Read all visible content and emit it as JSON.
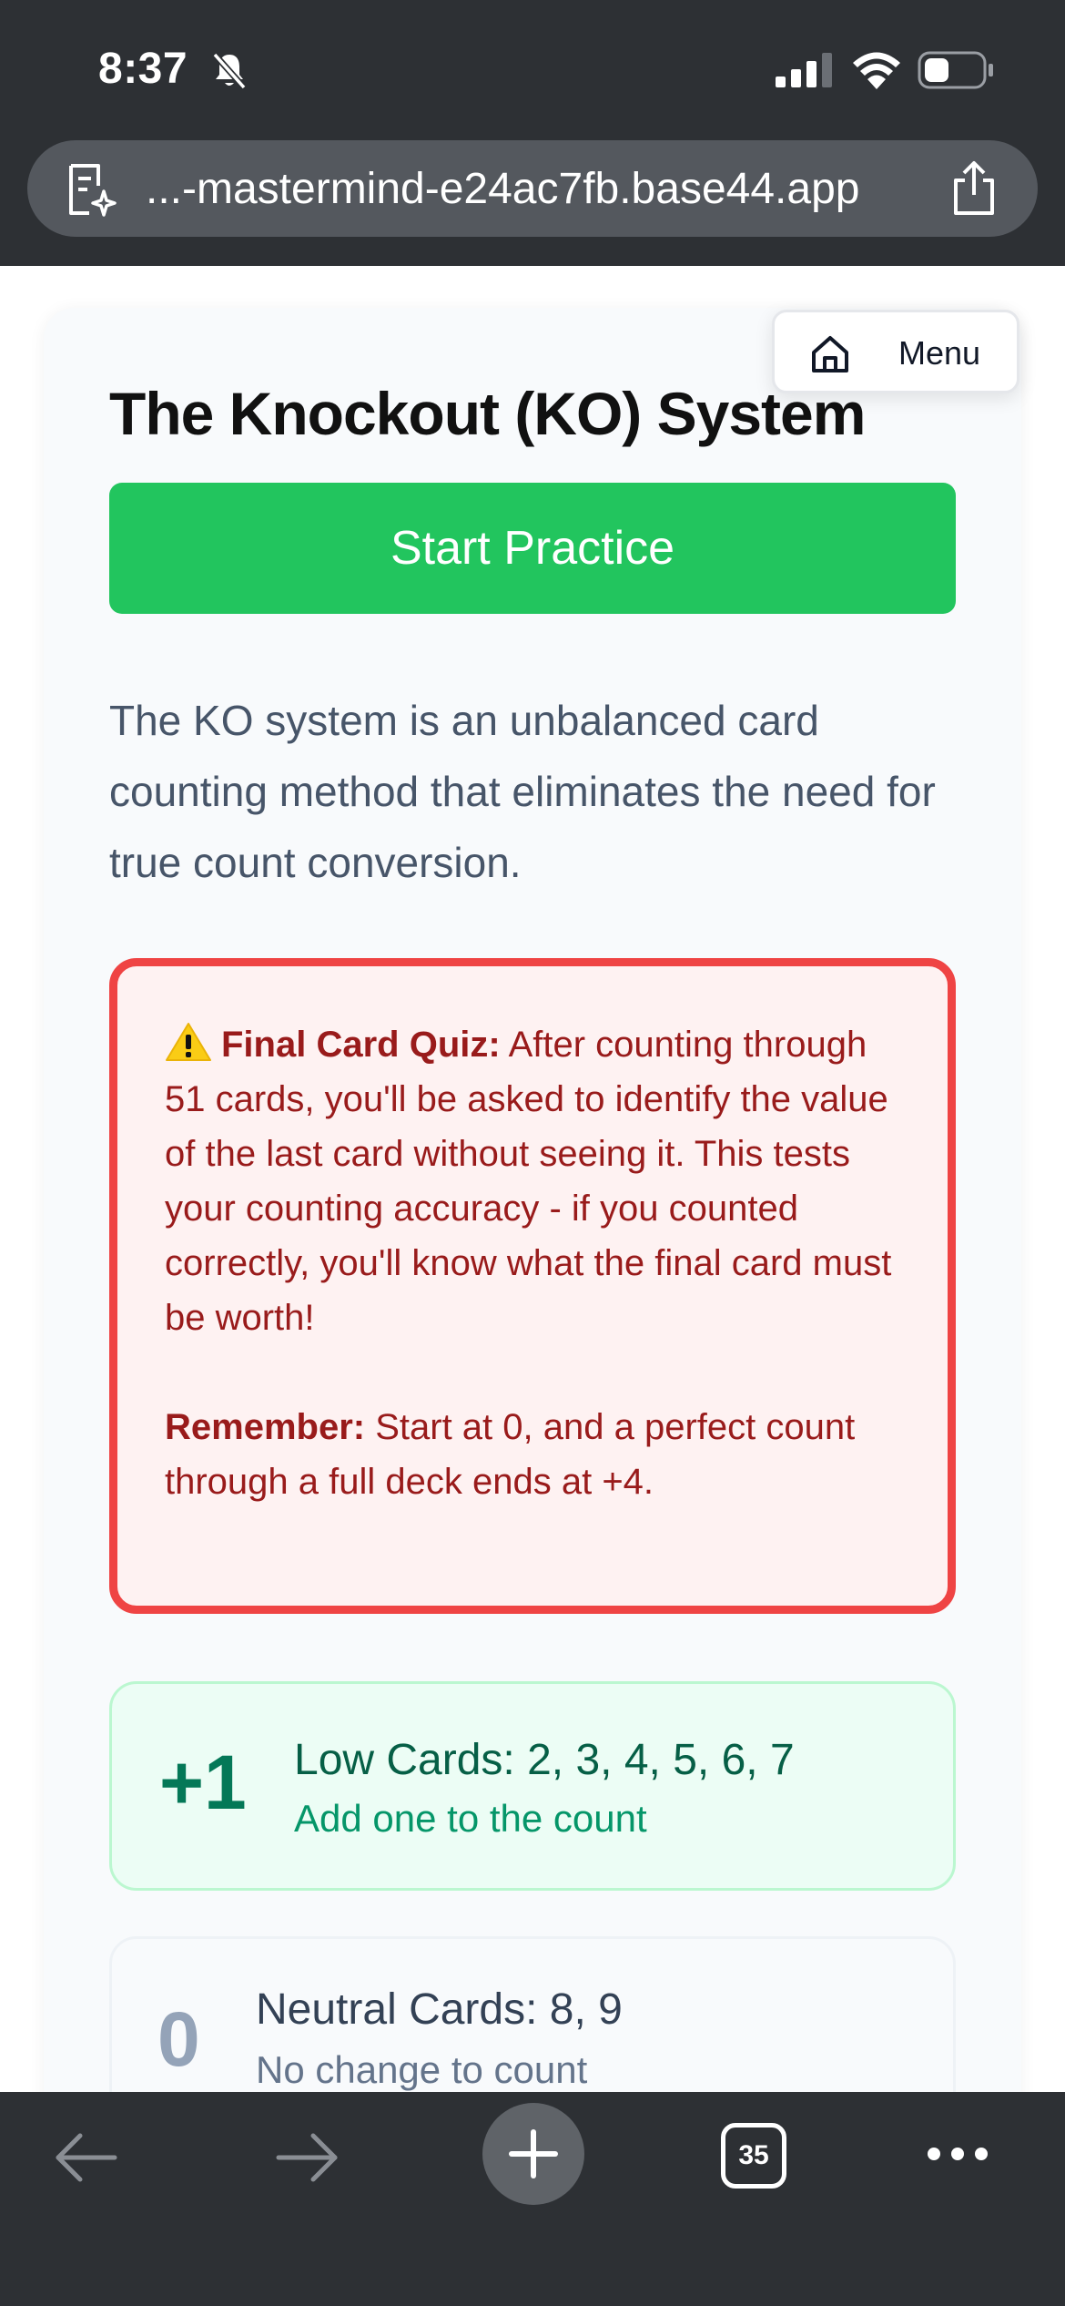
{
  "status_bar": {
    "time": "8:37"
  },
  "browser": {
    "url": "...-mastermind-e24ac7fb.base44.app",
    "tab_count": "35"
  },
  "menu": {
    "label": "Menu"
  },
  "page": {
    "title": "The Knockout (KO) System",
    "start_button": "Start Practice",
    "intro": "The KO system is an unbalanced card counting method that eliminates the need for true count conversion."
  },
  "warning": {
    "heading": "Final Card Quiz:",
    "body": "After counting through 51 cards, you'll be asked to identify the value of the last card without seeing it. This tests your counting accuracy - if you counted correctly, you'll know what the final card must be worth!",
    "remember_label": "Remember:",
    "remember_text": "Start at 0, and a perfect count through a full deck ends at +4."
  },
  "rules": [
    {
      "value": "+1",
      "title": "Low Cards: 2, 3, 4, 5, 6, 7",
      "description": "Add one to the count"
    },
    {
      "value": "0",
      "title": "Neutral Cards: 8, 9",
      "description": "No change to count"
    }
  ],
  "colors": {
    "accent_green": "#22c55e",
    "warning_red": "#ef4444",
    "chrome_dark": "#2d3034"
  }
}
